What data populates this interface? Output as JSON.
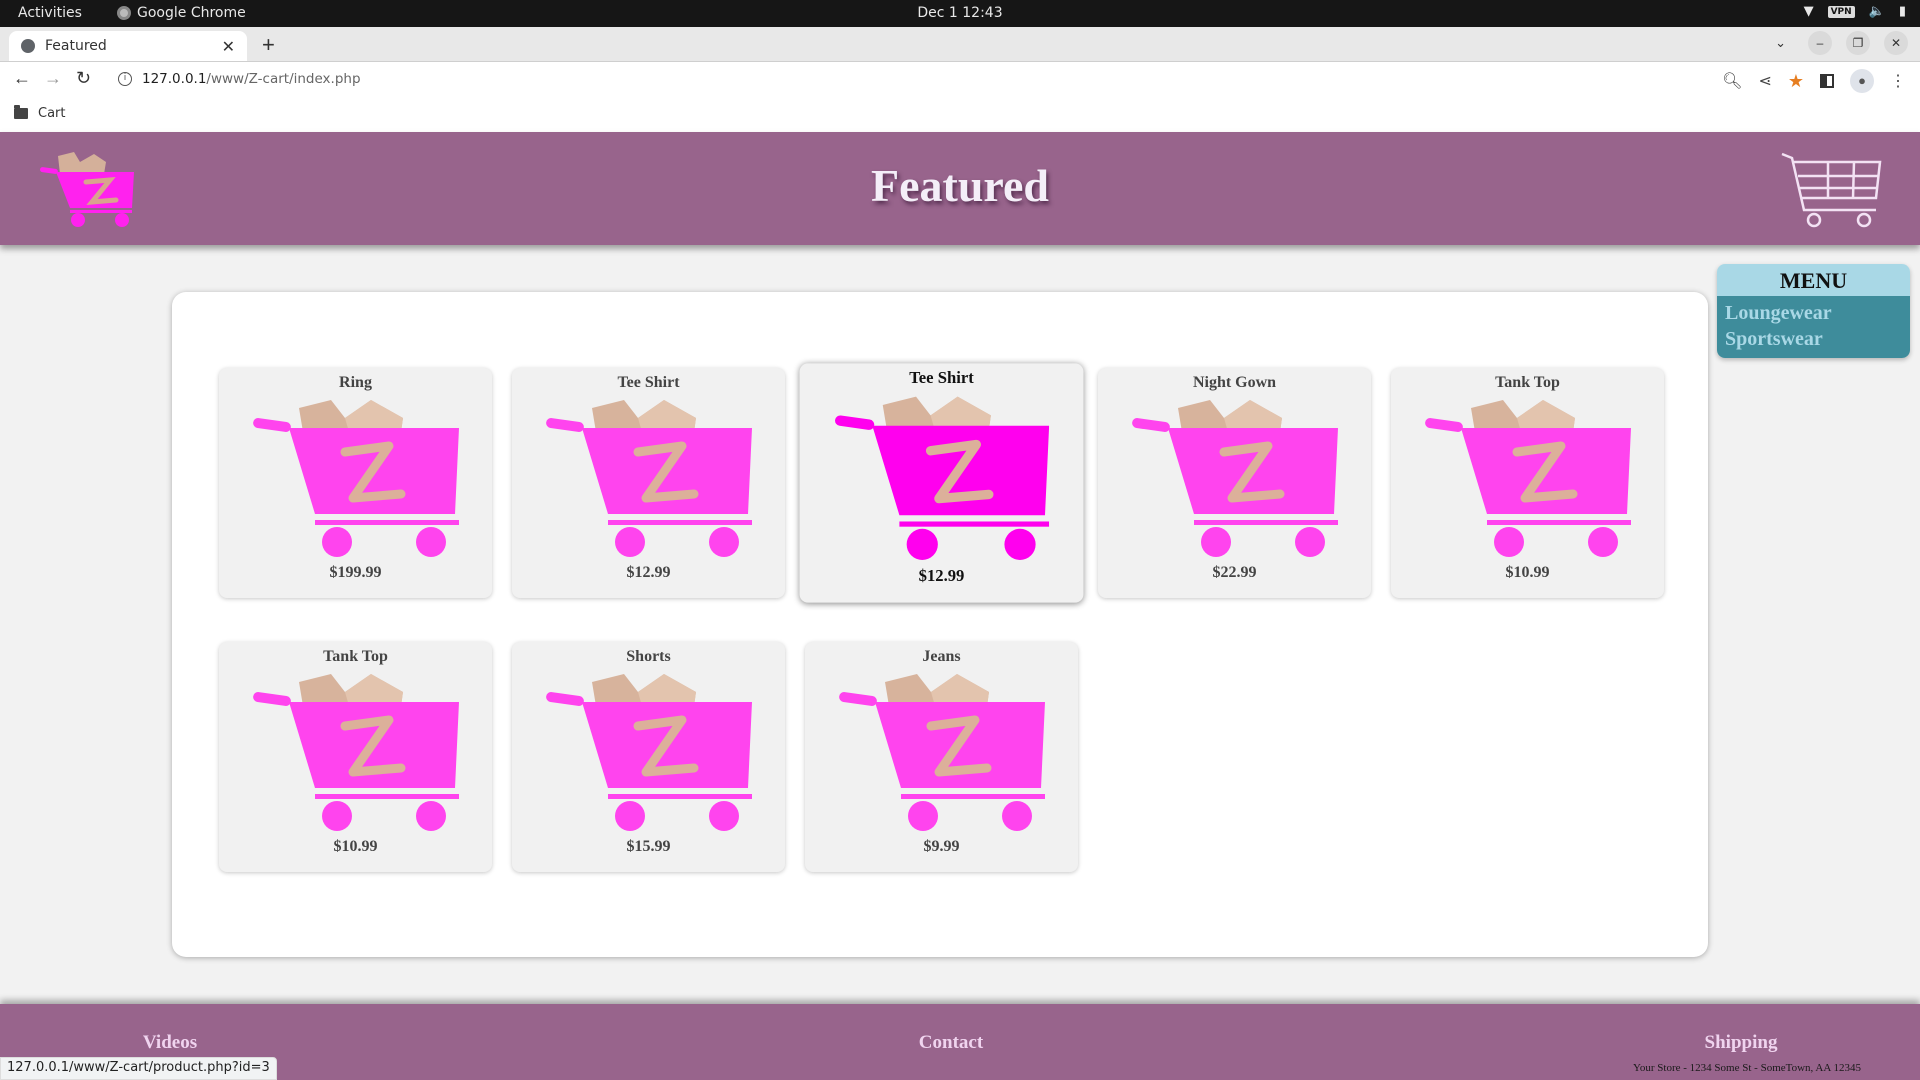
{
  "os": {
    "activities": "Activities",
    "app_name": "Google Chrome",
    "clock": "Dec 1  12:43",
    "tray": {
      "vpn_label": "VPN"
    }
  },
  "browser": {
    "tab_title": "Featured",
    "new_tab": "+",
    "url_host": "127.0.0.1",
    "url_path": "/www/Z-cart/index.php",
    "bookmark": "Cart",
    "status_url": "127.0.0.1/www/Z-cart/product.php?id=3"
  },
  "site": {
    "title": "Featured",
    "menu": {
      "heading": "MENU",
      "items": [
        {
          "label": "Loungewear"
        },
        {
          "label": "Sportswear"
        }
      ]
    },
    "products": [
      {
        "name": "Ring",
        "price": "$199.99"
      },
      {
        "name": "Tee Shirt",
        "price": "$12.99"
      },
      {
        "name": "Tee Shirt",
        "price": "$12.99",
        "hovered": true
      },
      {
        "name": "Night Gown",
        "price": "$22.99"
      },
      {
        "name": "Tank Top",
        "price": "$10.99"
      },
      {
        "name": "Tank Top",
        "price": "$10.99"
      },
      {
        "name": "Shorts",
        "price": "$15.99"
      },
      {
        "name": "Jeans",
        "price": "$9.99"
      }
    ],
    "footer": {
      "links": [
        {
          "label": "Videos"
        },
        {
          "label": "Contact"
        },
        {
          "label": "Shipping"
        }
      ],
      "address": "Your Store - 1234 Some St - SomeTown, AA 12345"
    },
    "colors": {
      "header_bg": "#98648c",
      "cart_pink": "#ff44ee",
      "menu_head": "#a9d8e6",
      "menu_body": "#3e8c9b"
    }
  }
}
